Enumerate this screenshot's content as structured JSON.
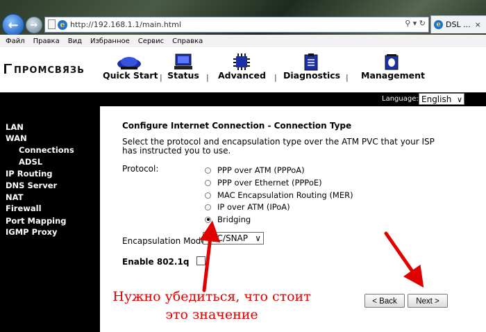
{
  "browser": {
    "address": "http://192.168.1.1/main.html",
    "tab_title": "DSL ...",
    "tab_close": "×",
    "menu": [
      "Файл",
      "Правка",
      "Вид",
      "Избранное",
      "Сервис",
      "Справка"
    ]
  },
  "header": {
    "logo": "ПРОМСВЯЗЬ",
    "nav": [
      "Quick Start",
      "Status",
      "Advanced",
      "Diagnostics",
      "Management"
    ],
    "separator": "|",
    "language_label": "Language:",
    "language_value": "English"
  },
  "sidebar": {
    "items": [
      "LAN",
      "WAN",
      "Connections",
      "ADSL",
      "IP Routing",
      "DNS Server",
      "NAT",
      "Firewall",
      "Port Mapping",
      "IGMP Proxy"
    ]
  },
  "content": {
    "title": "Configure Internet Connection - Connection Type",
    "instruction": "Select the protocol and encapsulation type over the ATM PVC that your ISP has instructed you to use.",
    "protocol_label": "Protocol:",
    "protocols": [
      {
        "label": "PPP over ATM (PPPoA)",
        "checked": false
      },
      {
        "label": "PPP over Ethernet (PPPoE)",
        "checked": false
      },
      {
        "label": "MAC Encapsulation Routing (MER)",
        "checked": false
      },
      {
        "label": "IP over ATM (IPoA)",
        "checked": false
      },
      {
        "label": "Bridging",
        "checked": true
      }
    ],
    "encapsulation_label": "Encapsulation Mode:",
    "encapsulation_value": "LLC/SNAP",
    "enable_8021q_label": "Enable 802.1q",
    "enable_8021q_checked": false,
    "back_label": "< Back",
    "next_label": "Next >"
  },
  "annotation": {
    "line1": "Нужно убедиться, что стоит",
    "line2": "это значение",
    "color": "#e00000"
  }
}
